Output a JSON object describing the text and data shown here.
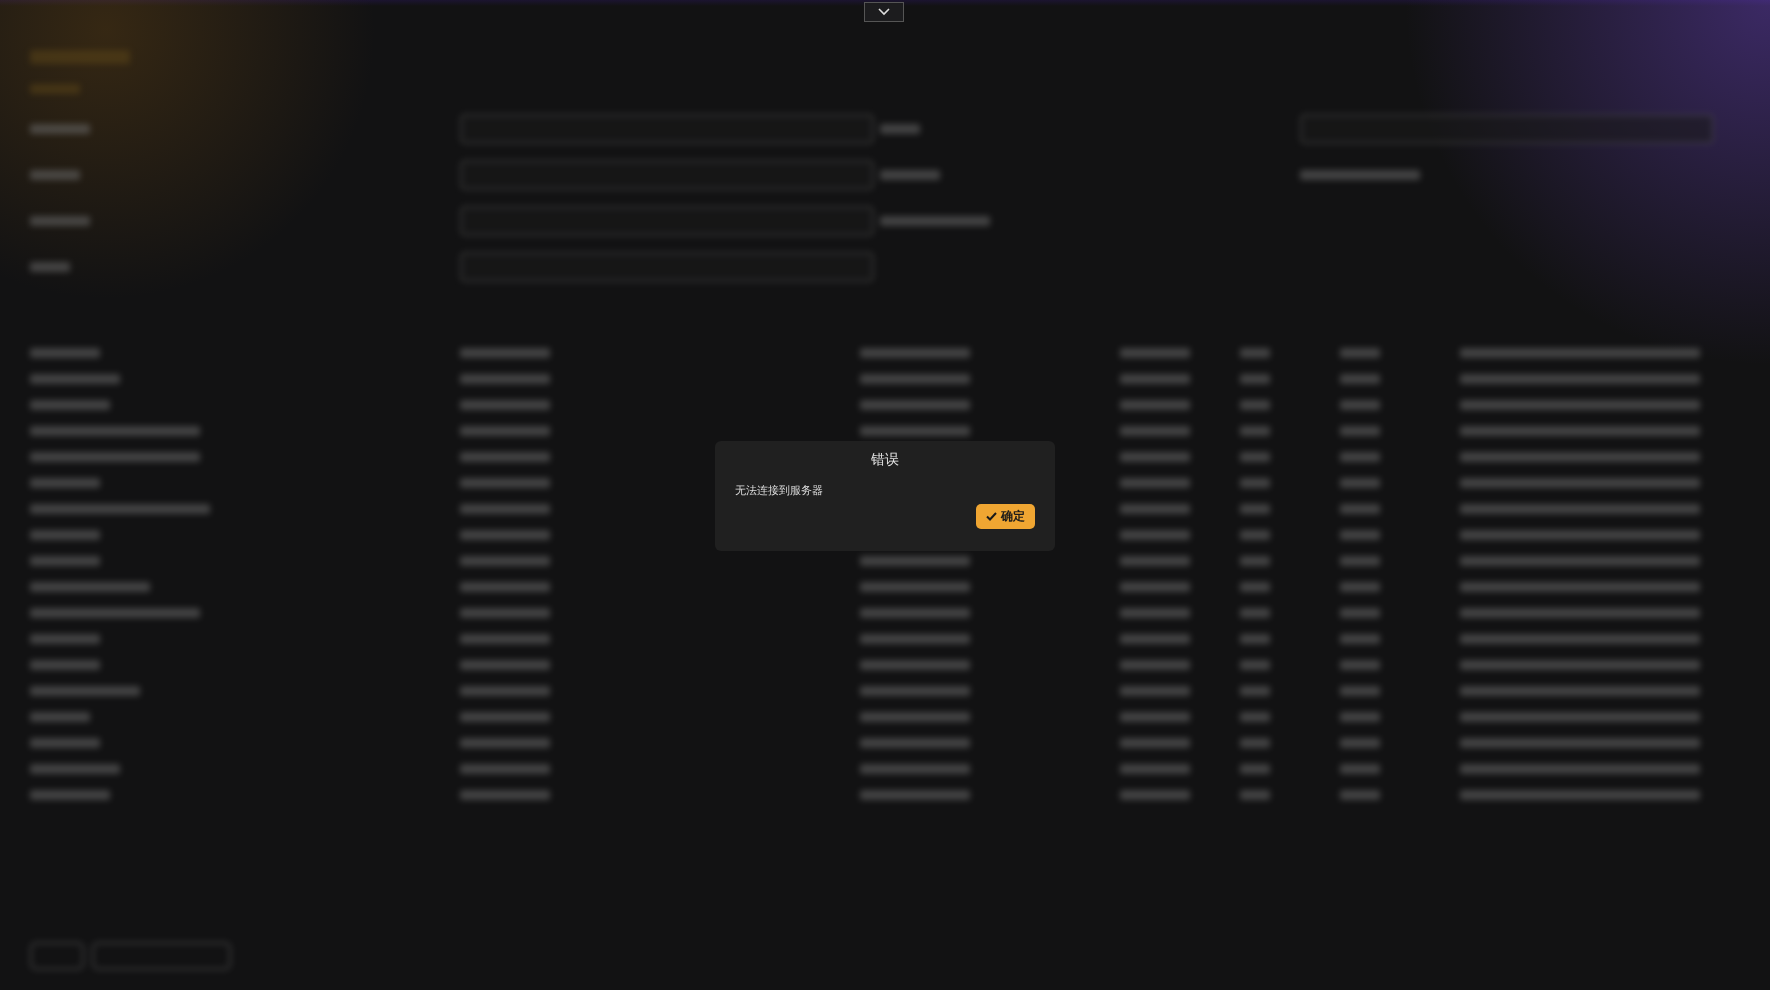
{
  "dialog": {
    "title": "错误",
    "message": "无法连接到服务器",
    "button": {
      "label": "确定"
    }
  }
}
